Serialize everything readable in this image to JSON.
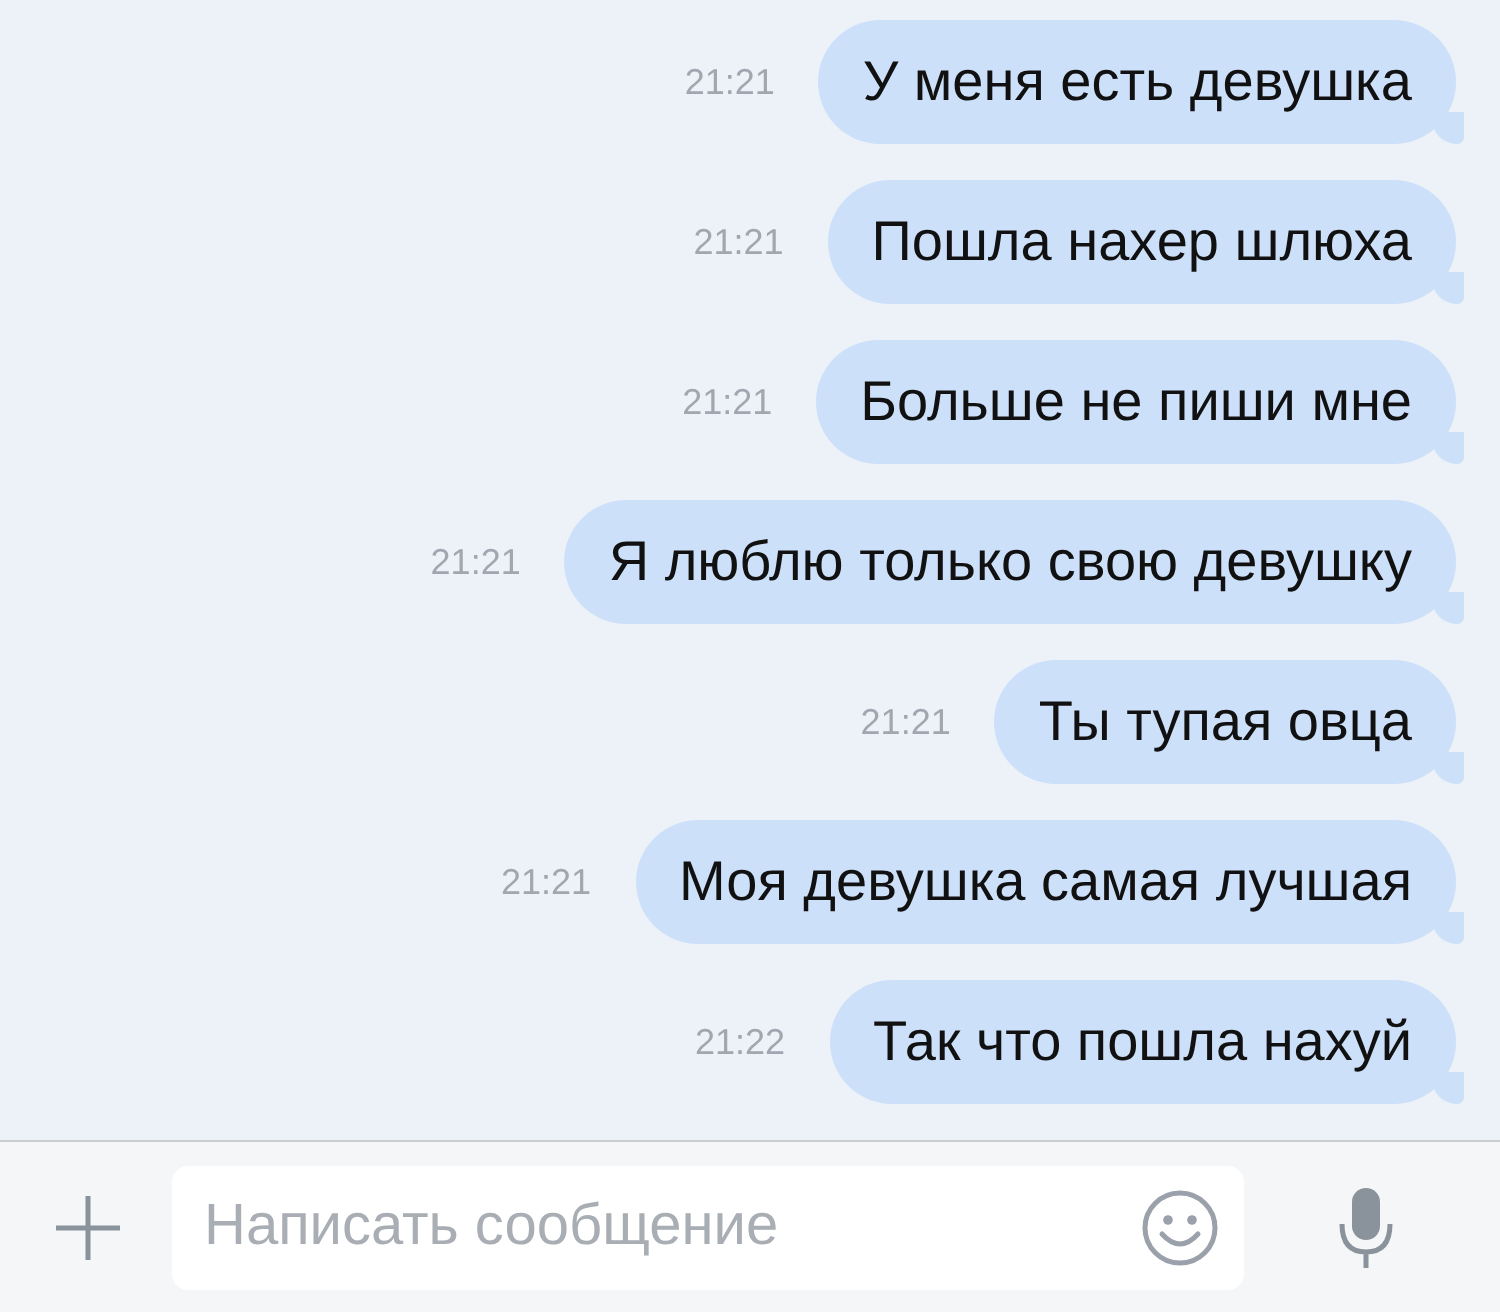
{
  "messages": [
    {
      "text": "У меня есть девушка",
      "time": "21:21"
    },
    {
      "text": "Пошла нахер шлюха",
      "time": "21:21"
    },
    {
      "text": "Больше не пиши мне",
      "time": "21:21"
    },
    {
      "text": "Я люблю только свою девушку",
      "time": "21:21"
    },
    {
      "text": "Ты тупая овца",
      "time": "21:21"
    },
    {
      "text": "Моя девушка самая лучшая",
      "time": "21:21"
    },
    {
      "text": "Так что пошла нахуй",
      "time": "21:22"
    }
  ],
  "composer": {
    "placeholder": "Написать сообщение"
  }
}
